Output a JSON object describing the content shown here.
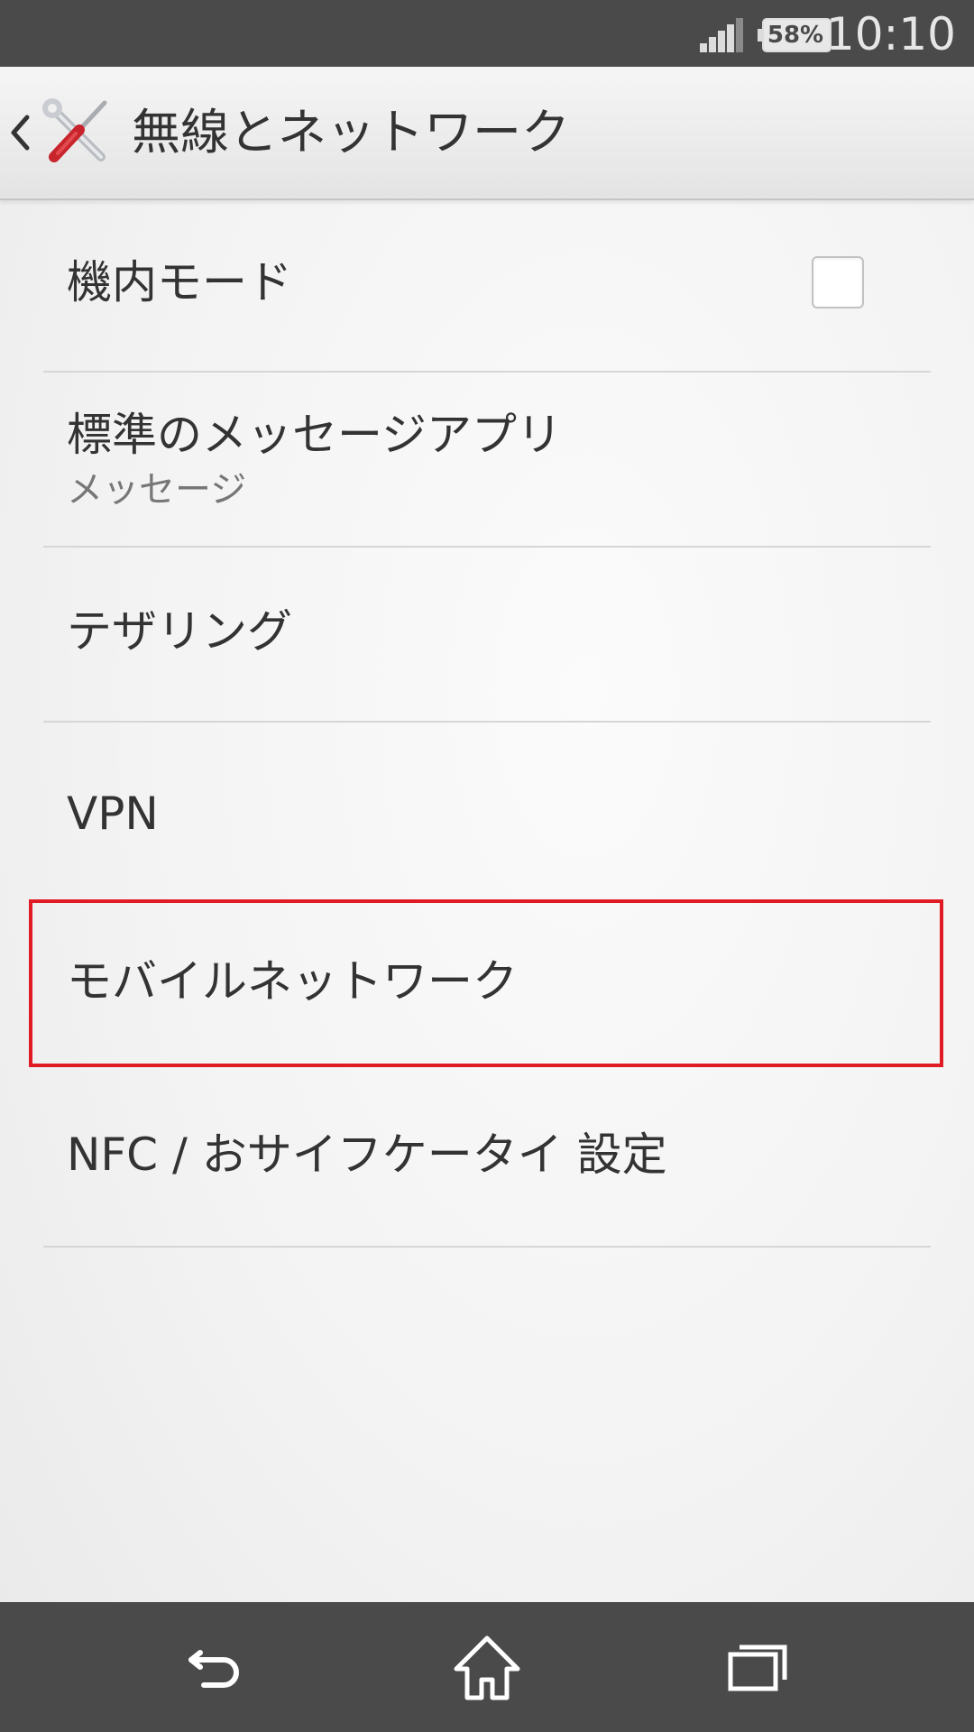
{
  "status_bar": {
    "battery_percent": "58%",
    "time": "10:10",
    "icons": [
      "signal-icon",
      "battery-icon"
    ]
  },
  "action_bar": {
    "title": "無線とネットワーク",
    "icons": [
      "back-chevron-icon",
      "tools-icon"
    ]
  },
  "settings": {
    "items": [
      {
        "title": "機内モード",
        "checked": false
      },
      {
        "title": "標準のメッセージアプリ",
        "subtitle": "メッセージ"
      },
      {
        "title": "テザリング"
      },
      {
        "title": "VPN"
      },
      {
        "title": "モバイルネットワーク",
        "highlighted": true
      },
      {
        "title": "NFC / おサイフケータイ 設定"
      }
    ]
  },
  "nav_bar": {
    "icons": [
      "back-icon",
      "home-icon",
      "recent-apps-icon"
    ]
  },
  "colors": {
    "highlight": "#e01b24",
    "bars": "#4a4a4a",
    "text": "#333333",
    "subtext": "#777777"
  }
}
